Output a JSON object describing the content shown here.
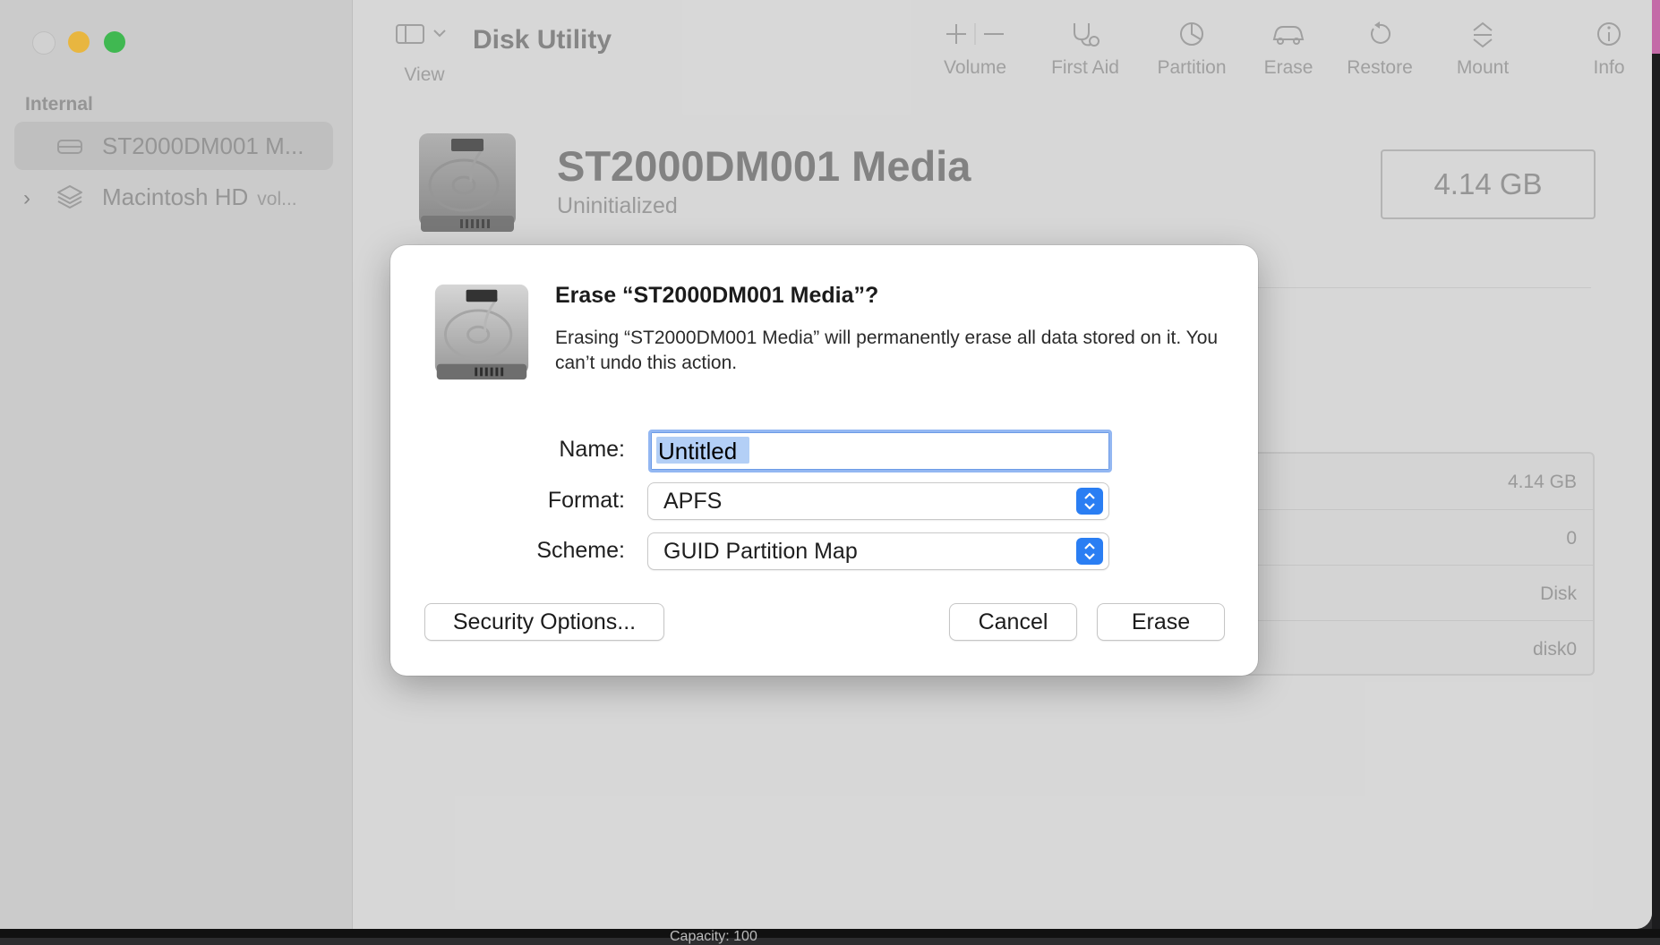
{
  "window": {
    "toolbar": {
      "title": "Disk Utility",
      "view_label": "View",
      "tools": [
        {
          "icon": "plus-minus-icon",
          "label": "Volume"
        },
        {
          "icon": "stethoscope-icon",
          "label": "First Aid"
        },
        {
          "icon": "pie-chart-icon",
          "label": "Partition"
        },
        {
          "icon": "eraser-car-icon",
          "label": "Erase"
        },
        {
          "icon": "restore-icon",
          "label": "Restore"
        },
        {
          "icon": "mount-icon",
          "label": "Mount"
        },
        {
          "icon": "info-icon",
          "label": "Info"
        }
      ]
    },
    "sidebar": {
      "section": "Internal",
      "items": [
        {
          "label": "ST2000DM001 M...",
          "sub": "",
          "icon": "drive-icon",
          "selected": true
        },
        {
          "label": "Macintosh HD",
          "sub": "vol...",
          "icon": "layers-icon",
          "selected": false
        }
      ]
    },
    "disk": {
      "name": "ST2000DM001 Media",
      "status": "Uninitialized",
      "size": "4.14 GB"
    },
    "info_rows": [
      "4.14 GB",
      "0",
      "Disk",
      "disk0"
    ],
    "bottom_partial": "Capacity: 100"
  },
  "dialog": {
    "title": "Erase “ST2000DM001 Media”?",
    "message": "Erasing “ST2000DM001 Media” will permanently erase all data stored on it. You can’t undo this action.",
    "name_label": "Name:",
    "name_value": "Untitled",
    "format_label": "Format:",
    "format_value": "APFS",
    "scheme_label": "Scheme:",
    "scheme_value": "GUID Partition Map",
    "security_button": "Security Options...",
    "cancel_button": "Cancel",
    "erase_button": "Erase"
  },
  "colors": {
    "accent": "#2a7ef3",
    "focus_ring": "#93b7f2",
    "traffic_min": "#f7bf3c",
    "traffic_max": "#3cc14e"
  }
}
